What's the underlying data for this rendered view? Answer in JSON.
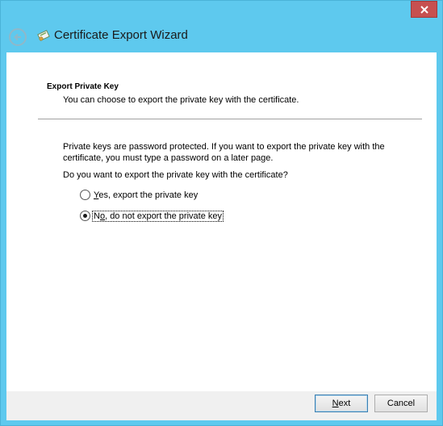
{
  "window": {
    "title": "Certificate Export Wizard",
    "close_icon": "close-icon",
    "back_icon": "back-arrow-icon",
    "wizard_icon": "certificate-icon"
  },
  "page": {
    "heading": "Export Private Key",
    "subheading": "You can choose to export the private key with the certificate.",
    "paragraph": "Private keys are password protected. If you want to export the private key with the certificate, you must type a password on a later page.",
    "question": "Do you want to export the private key with the certificate?",
    "options": [
      {
        "accel": "Y",
        "rest": "es, export the private key",
        "selected": false
      },
      {
        "accel": "o",
        "prefix": "N",
        "rest": ", do not export the private key",
        "selected": true
      }
    ]
  },
  "footer": {
    "next_accel": "N",
    "next_rest": "ext",
    "cancel": "Cancel"
  },
  "colors": {
    "frame": "#5ec9ee",
    "close": "#c75050",
    "footer": "#f0f0f0"
  }
}
